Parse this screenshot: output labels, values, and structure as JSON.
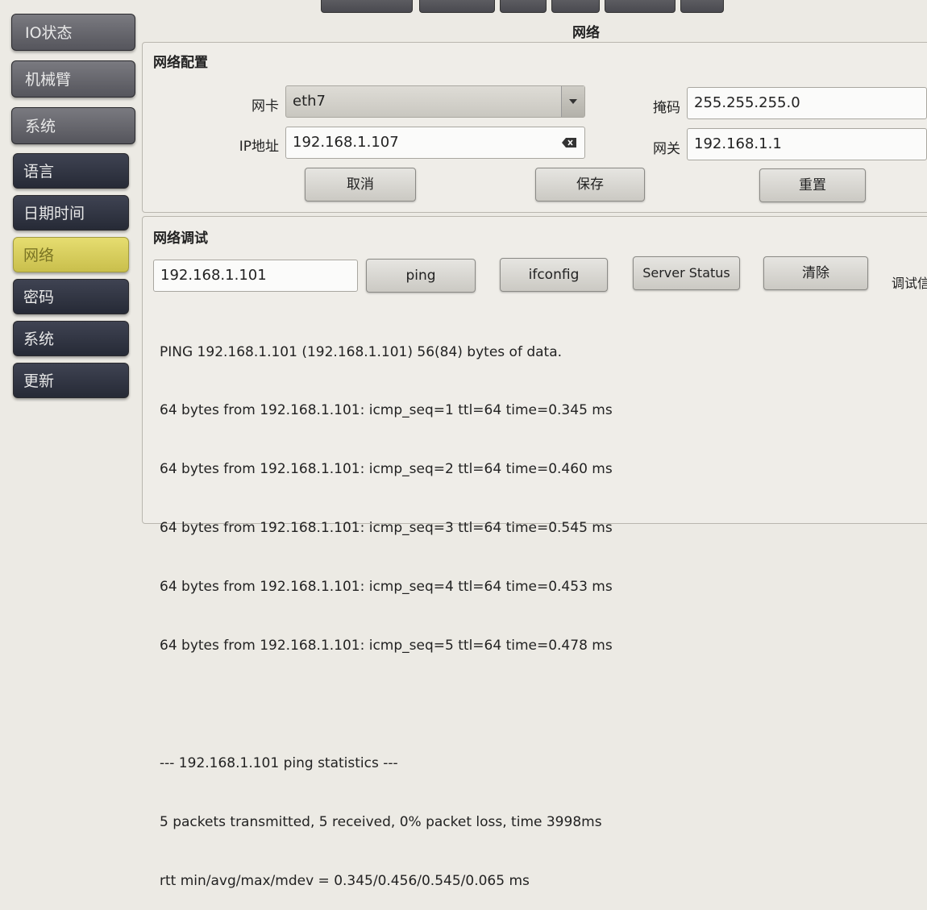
{
  "header": {
    "title": "网络"
  },
  "sidebar": {
    "main_items": [
      {
        "label": "IO状态"
      },
      {
        "label": "机械臂"
      },
      {
        "label": "系统"
      }
    ],
    "sub_items": [
      {
        "label": "语言"
      },
      {
        "label": "日期时间"
      },
      {
        "label": "网络",
        "active": true
      },
      {
        "label": "密码"
      },
      {
        "label": "系统"
      },
      {
        "label": "更新"
      }
    ]
  },
  "network_config": {
    "title": "网络配置",
    "nic_label": "网卡",
    "nic_value": "eth7",
    "ip_label": "IP地址",
    "ip_value": "192.168.1.107",
    "mask_label": "掩码",
    "mask_value": "255.255.255.0",
    "gateway_label": "网关",
    "gateway_value": "192.168.1.1",
    "cancel_label": "取消",
    "save_label": "保存",
    "reset_label": "重置"
  },
  "network_debug": {
    "title": "网络调试",
    "target_value": "192.168.1.101",
    "ping_label": "ping",
    "ifconfig_label": "ifconfig",
    "server_status_label": "Server Status",
    "clear_label": "清除",
    "side_label": "调试信",
    "output_lines": [
      "PING 192.168.1.101 (192.168.1.101) 56(84) bytes of data.",
      "64 bytes from 192.168.1.101: icmp_seq=1 ttl=64 time=0.345 ms",
      "64 bytes from 192.168.1.101: icmp_seq=2 ttl=64 time=0.460 ms",
      "64 bytes from 192.168.1.101: icmp_seq=3 ttl=64 time=0.545 ms",
      "64 bytes from 192.168.1.101: icmp_seq=4 ttl=64 time=0.453 ms",
      "64 bytes from 192.168.1.101: icmp_seq=5 ttl=64 time=0.478 ms",
      "",
      "--- 192.168.1.101 ping statistics ---",
      "5 packets transmitted, 5 received, 0% packet loss, time 3998ms",
      "rtt min/avg/max/mdev = 0.345/0.456/0.545/0.065 ms"
    ]
  },
  "colors": {
    "active_nav": "#d9cf5e",
    "nav_dark": "#2f3340",
    "background": "#eceae4"
  }
}
